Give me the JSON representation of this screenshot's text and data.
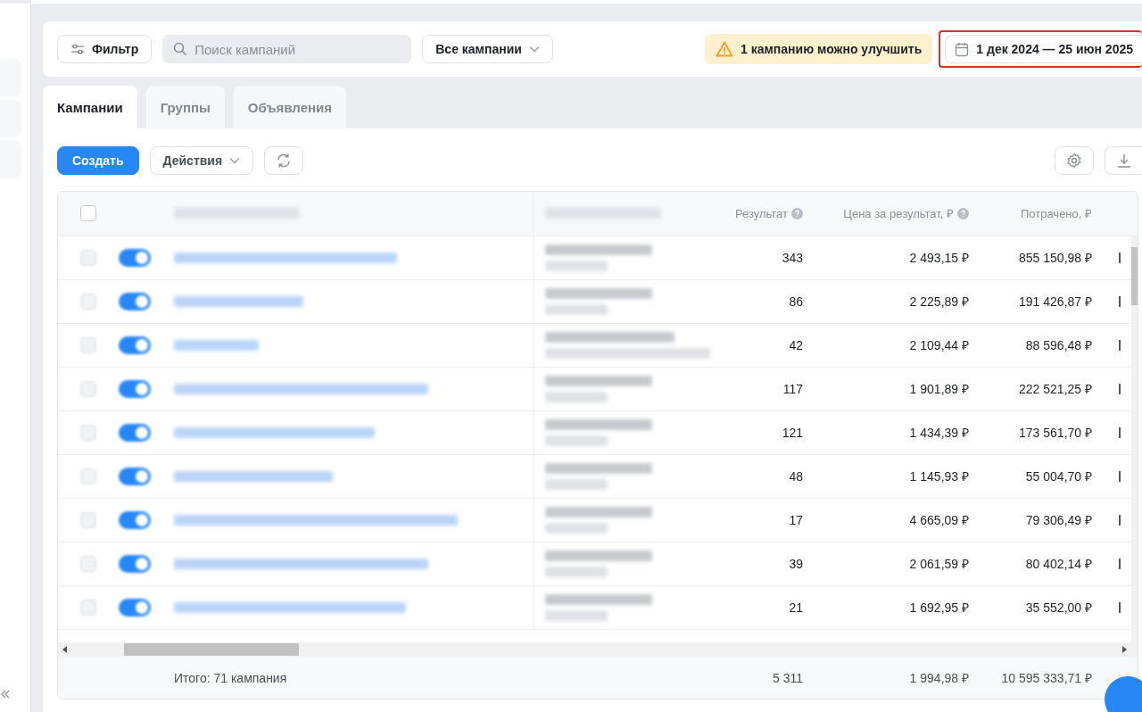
{
  "filter_bar": {
    "filter_button": "Фильтр",
    "search": {
      "placeholder": "Поиск кампаний"
    },
    "campaign_select": "Все кампании",
    "notice": "1 кампанию можно улучшить",
    "date_range": "1 дек 2024 — 25 июн 2025",
    "date_highlighted": true
  },
  "tabs": [
    {
      "label": "Кампании",
      "selected": true
    },
    {
      "label": "Группы",
      "selected": false
    },
    {
      "label": "Объявления",
      "selected": false
    }
  ],
  "toolbar": {
    "create_button": "Создать",
    "actions_button": "Действия"
  },
  "table": {
    "columns": [
      {
        "label": "Результат",
        "help": true
      },
      {
        "label": "Цена за результат, ₽",
        "help": true
      },
      {
        "label": "Потрачено, ₽",
        "help": false
      }
    ],
    "rows": [
      {
        "checked": false,
        "on": true,
        "result": "343",
        "cost_per_result": "2 493,15 ₽",
        "spent": "855 150,98 ₽"
      },
      {
        "checked": false,
        "on": true,
        "result": "86",
        "cost_per_result": "2 225,89 ₽",
        "spent": "191 426,87 ₽"
      },
      {
        "checked": false,
        "on": true,
        "result": "42",
        "cost_per_result": "2 109,44 ₽",
        "spent": "88 596,48 ₽"
      },
      {
        "checked": false,
        "on": true,
        "result": "117",
        "cost_per_result": "1 901,89 ₽",
        "spent": "222 521,25 ₽"
      },
      {
        "checked": false,
        "on": true,
        "result": "121",
        "cost_per_result": "1 434,39 ₽",
        "spent": "173 561,70 ₽"
      },
      {
        "checked": false,
        "on": true,
        "result": "48",
        "cost_per_result": "1 145,93 ₽",
        "spent": "55 004,70 ₽"
      },
      {
        "checked": false,
        "on": true,
        "result": "17",
        "cost_per_result": "4 665,09 ₽",
        "spent": "79 306,49 ₽"
      },
      {
        "checked": false,
        "on": true,
        "result": "39",
        "cost_per_result": "2 061,59 ₽",
        "spent": "80 402,14 ₽"
      },
      {
        "checked": false,
        "on": true,
        "result": "21",
        "cost_per_result": "1 692,95 ₽",
        "spent": "35 552,00 ₽"
      }
    ],
    "select_all_checked": false,
    "totals": {
      "label": "Итого: 71 кампания",
      "result": "5 311",
      "cost_per_result": "1 994,98 ₽",
      "spent": "10 595 333,71 ₽"
    }
  }
}
